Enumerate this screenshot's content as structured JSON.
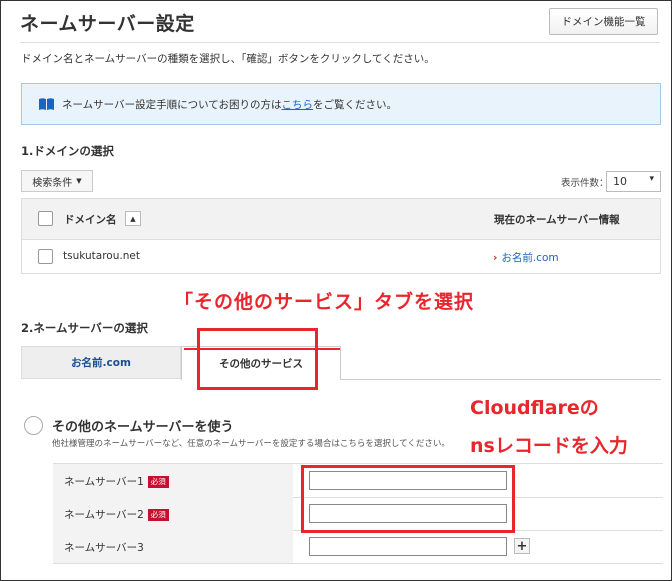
{
  "page": {
    "title": "ネームサーバー設定",
    "domain_menu_button": "ドメイン機能一覧",
    "intro": "ドメイン名とネームサーバーの種類を選択し、「確認」ボタンをクリックしてください。"
  },
  "info": {
    "icon": "book-icon",
    "text_before": "ネームサーバー設定手順についてお困りの方は",
    "link": "こちら",
    "text_after": "をご覧ください。"
  },
  "section1": {
    "heading": "1.ドメインの選択",
    "filter_button": "検索条件",
    "count_label": "表示件数：",
    "count_value": "10",
    "table": {
      "col_domain": "ドメイン名",
      "col_current": "現在のネームサーバー情報",
      "rows": [
        {
          "domain": "tsukutarou.net",
          "current": "お名前.com"
        }
      ]
    }
  },
  "section2": {
    "heading": "2.ネームサーバーの選択",
    "tabs": [
      "お名前.com",
      "その他のサービス"
    ],
    "option_title": "その他のネームサーバーを使う",
    "option_desc": "他社様管理のネームサーバーなど、任意のネームサーバーを設定する場合はこちらを選択してください。",
    "required_badge": "必須",
    "nameservers": [
      {
        "label": "ネームサーバー1",
        "value": ""
      },
      {
        "label": "ネームサーバー2",
        "value": ""
      },
      {
        "label": "ネームサーバー3",
        "value": ""
      }
    ]
  },
  "annotations": {
    "tab_note": "「その他のサービス」タブを選択",
    "ns_note_line1": "Cloudflareの",
    "ns_note_line2": "nsレコードを入力",
    "color": "#e8262d"
  }
}
